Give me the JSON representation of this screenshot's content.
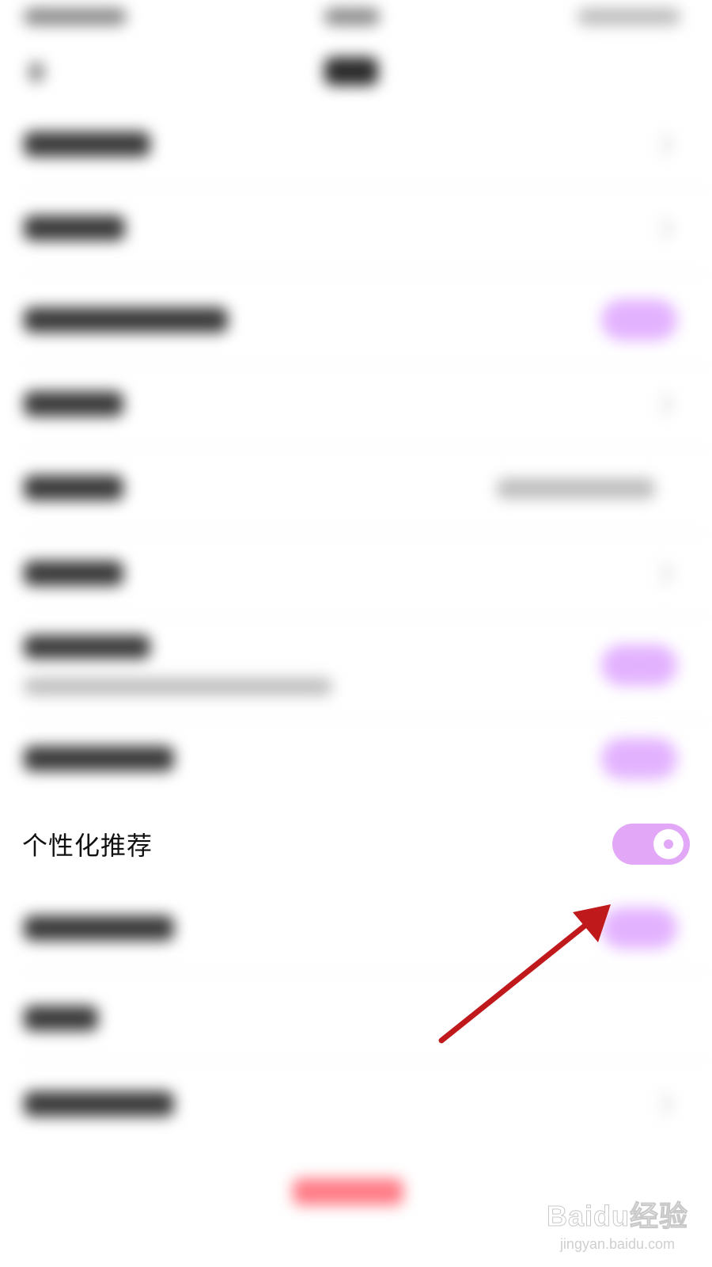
{
  "settings": {
    "personalized_recommendation": {
      "label": "个性化推荐",
      "toggle_on": true
    }
  },
  "colors": {
    "toggle_accent": "#e2a7f7",
    "annotation_arrow": "#c0191b"
  },
  "watermark": {
    "brand": "Baidu经验",
    "url": "jingyan.baidu.com"
  }
}
